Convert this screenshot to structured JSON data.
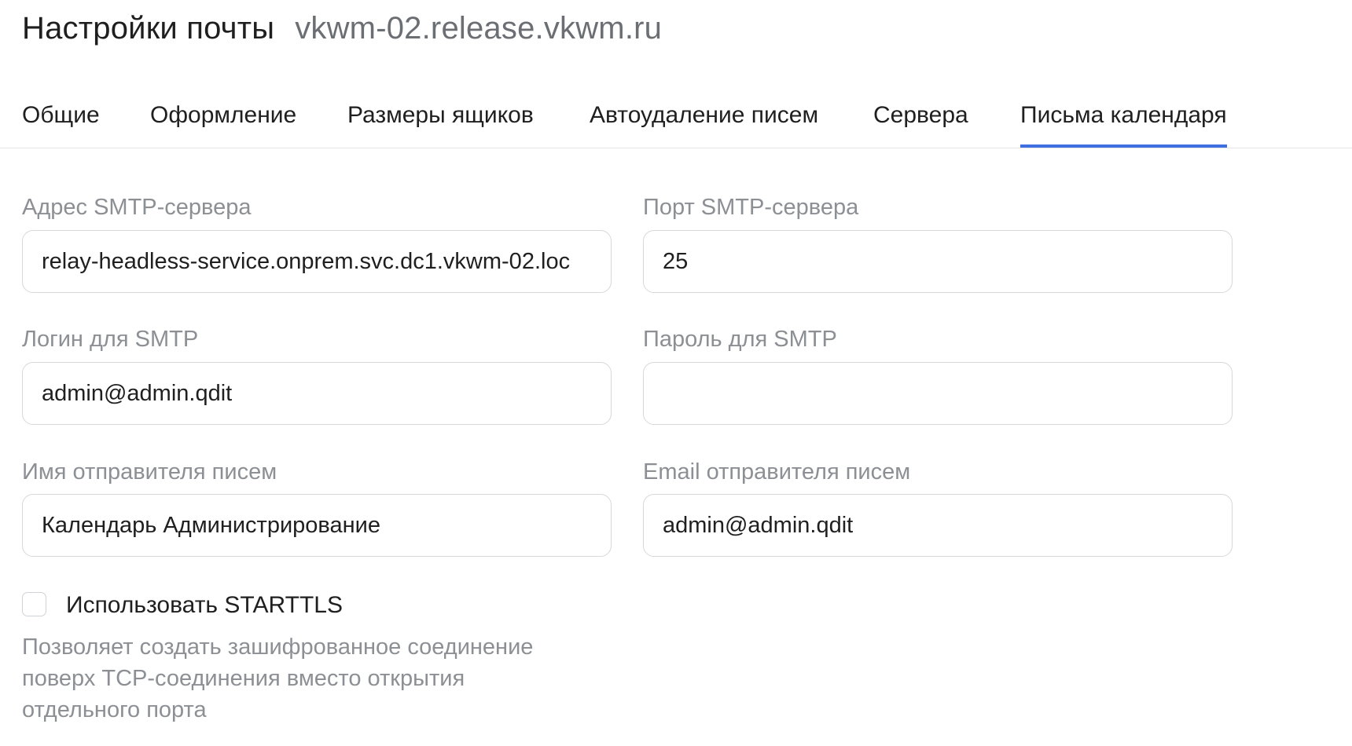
{
  "header": {
    "title": "Настройки почты",
    "subtitle": "vkwm-02.release.vkwm.ru"
  },
  "tabs": [
    {
      "label": "Общие",
      "active": false
    },
    {
      "label": "Оформление",
      "active": false
    },
    {
      "label": "Размеры ящиков",
      "active": false
    },
    {
      "label": "Автоудаление писем",
      "active": false
    },
    {
      "label": "Сервера",
      "active": false
    },
    {
      "label": "Письма календаря",
      "active": true
    }
  ],
  "colors": {
    "accent": "#3f6fe0",
    "label": "#8c8f94",
    "border": "#d6d8dc"
  },
  "form": {
    "smtp_host": {
      "label": "Адрес SMTP-сервера",
      "value": "relay-headless-service.onprem.svc.dc1.vkwm-02.loc"
    },
    "smtp_port": {
      "label": "Порт SMTP-сервера",
      "value": "25"
    },
    "smtp_login": {
      "label": "Логин для SMTP",
      "value": "admin@admin.qdit"
    },
    "smtp_password": {
      "label": "Пароль для SMTP",
      "value": ""
    },
    "sender_name": {
      "label": "Имя отправителя писем",
      "value": "Календарь Администрирование"
    },
    "sender_email": {
      "label": "Email отправителя писем",
      "value": "admin@admin.qdit"
    },
    "starttls": {
      "label": "Использовать STARTTLS",
      "checked": false,
      "hint": "Позволяет создать зашифрованное соединение поверх TCP-соединения вместо открытия отдельного порта"
    }
  }
}
